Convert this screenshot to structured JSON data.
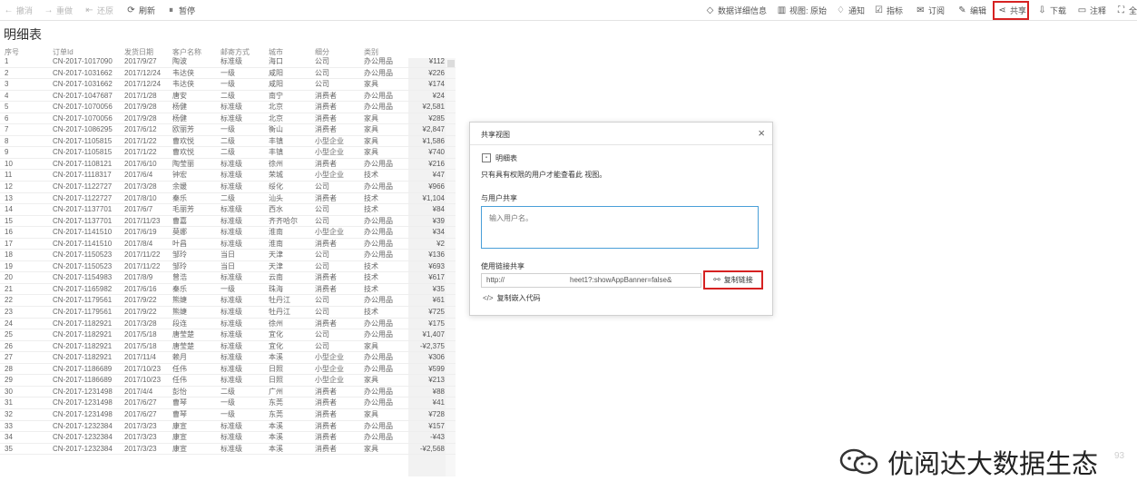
{
  "toolbar": {
    "undo": "撤消",
    "redo": "重做",
    "revert": "还原",
    "refresh": "刷新",
    "pause": "暂停",
    "data_details": "数据详细信息",
    "view": "视图: 原始",
    "alert": "通知",
    "metrics": "指标",
    "subscribe": "订阅",
    "edit": "编辑",
    "share": "共享",
    "download": "下载",
    "comments": "注释",
    "fullscreen": "全屏"
  },
  "sheet_title": "明细表",
  "table": {
    "headers": [
      "序号",
      "订单Id",
      "发货日期",
      "客户名称",
      "邮寄方式",
      "城市",
      "细分",
      "类别"
    ],
    "rows": [
      [
        "1",
        "CN-2017-1017090",
        "2017/9/27",
        "陶波",
        "标准级",
        "海口",
        "公司",
        "办公用品",
        "¥112"
      ],
      [
        "2",
        "CN-2017-1031662",
        "2017/12/24",
        "韦达侠",
        "一级",
        "咸阳",
        "公司",
        "办公用品",
        "¥226"
      ],
      [
        "3",
        "CN-2017-1031662",
        "2017/12/24",
        "韦达侠",
        "一级",
        "咸阳",
        "公司",
        "家具",
        "¥174"
      ],
      [
        "4",
        "CN-2017-1047687",
        "2017/1/28",
        "唐安",
        "二级",
        "南宁",
        "消费者",
        "办公用品",
        "¥24"
      ],
      [
        "5",
        "CN-2017-1070056",
        "2017/9/28",
        "杨健",
        "标准级",
        "北京",
        "消费者",
        "办公用品",
        "¥2,581"
      ],
      [
        "6",
        "CN-2017-1070056",
        "2017/9/28",
        "杨健",
        "标准级",
        "北京",
        "消费者",
        "家具",
        "¥285"
      ],
      [
        "7",
        "CN-2017-1086295",
        "2017/6/12",
        "欧丽芳",
        "一级",
        "衡山",
        "消费者",
        "家具",
        "¥2,847"
      ],
      [
        "8",
        "CN-2017-1105815",
        "2017/1/22",
        "曹欢悦",
        "二级",
        "丰镇",
        "小型企业",
        "家具",
        "¥1,586"
      ],
      [
        "9",
        "CN-2017-1105815",
        "2017/1/22",
        "曹欢悦",
        "二级",
        "丰镇",
        "小型企业",
        "家具",
        "¥740"
      ],
      [
        "10",
        "CN-2017-1108121",
        "2017/6/10",
        "陶莹丽",
        "标准级",
        "徐州",
        "消费者",
        "办公用品",
        "¥216"
      ],
      [
        "11",
        "CN-2017-1118317",
        "2017/6/4",
        "钟宏",
        "标准级",
        "荣城",
        "小型企业",
        "技术",
        "¥47"
      ],
      [
        "12",
        "CN-2017-1122727",
        "2017/3/28",
        "余媛",
        "标准级",
        "绥化",
        "公司",
        "办公用品",
        "¥966"
      ],
      [
        "13",
        "CN-2017-1122727",
        "2017/8/10",
        "秦乐",
        "二级",
        "汕头",
        "消费者",
        "技术",
        "¥1,104"
      ],
      [
        "14",
        "CN-2017-1137701",
        "2017/6/7",
        "毛丽芳",
        "标准级",
        "西水",
        "公司",
        "技术",
        "¥84"
      ],
      [
        "15",
        "CN-2017-1137701",
        "2017/11/23",
        "曹嘉",
        "标准级",
        "齐齐哈尔",
        "公司",
        "办公用品",
        "¥39"
      ],
      [
        "16",
        "CN-2017-1141510",
        "2017/6/19",
        "莫娜",
        "标准级",
        "淮南",
        "小型企业",
        "办公用品",
        "¥34"
      ],
      [
        "17",
        "CN-2017-1141510",
        "2017/8/4",
        "叶昌",
        "标准级",
        "淮南",
        "消费者",
        "办公用品",
        "¥2"
      ],
      [
        "18",
        "CN-2017-1150523",
        "2017/11/22",
        "邹玲",
        "当日",
        "天津",
        "公司",
        "办公用品",
        "¥136"
      ],
      [
        "19",
        "CN-2017-1150523",
        "2017/11/22",
        "邹玲",
        "当日",
        "天津",
        "公司",
        "技术",
        "¥693"
      ],
      [
        "20",
        "CN-2017-1154983",
        "2017/8/9",
        "曾浩",
        "标准级",
        "云南",
        "消费者",
        "技术",
        "¥617"
      ],
      [
        "21",
        "CN-2017-1165982",
        "2017/6/16",
        "秦乐",
        "一级",
        "珠海",
        "消费者",
        "技术",
        "¥35"
      ],
      [
        "22",
        "CN-2017-1179561",
        "2017/9/22",
        "熊婕",
        "标准级",
        "牡丹江",
        "公司",
        "办公用品",
        "¥61"
      ],
      [
        "23",
        "CN-2017-1179561",
        "2017/9/22",
        "熊婕",
        "标准级",
        "牡丹江",
        "公司",
        "技术",
        "¥725"
      ],
      [
        "24",
        "CN-2017-1182921",
        "2017/3/28",
        "段连",
        "标准级",
        "徐州",
        "消费者",
        "办公用品",
        "¥175"
      ],
      [
        "25",
        "CN-2017-1182921",
        "2017/5/18",
        "唐莹楚",
        "标准级",
        "宜化",
        "公司",
        "办公用品",
        "¥1,407"
      ],
      [
        "26",
        "CN-2017-1182921",
        "2017/5/18",
        "唐莹楚",
        "标准级",
        "宜化",
        "公司",
        "家具",
        "-¥2,375"
      ],
      [
        "27",
        "CN-2017-1182921",
        "2017/11/4",
        "赖月",
        "标准级",
        "本溪",
        "小型企业",
        "办公用品",
        "¥306"
      ],
      [
        "28",
        "CN-2017-1186689",
        "2017/10/23",
        "任伟",
        "标准级",
        "日照",
        "小型企业",
        "办公用品",
        "¥599"
      ],
      [
        "29",
        "CN-2017-1186689",
        "2017/10/23",
        "任伟",
        "标准级",
        "日照",
        "小型企业",
        "家具",
        "¥213"
      ],
      [
        "30",
        "CN-2017-1231498",
        "2017/4/4",
        "彭怡",
        "二级",
        "广州",
        "消费者",
        "办公用品",
        "¥88"
      ],
      [
        "31",
        "CN-2017-1231498",
        "2017/6/27",
        "曹琴",
        "一级",
        "东莞",
        "消费者",
        "办公用品",
        "¥41"
      ],
      [
        "32",
        "CN-2017-1231498",
        "2017/6/27",
        "曹琴",
        "一级",
        "东莞",
        "消费者",
        "家具",
        "¥728"
      ],
      [
        "33",
        "CN-2017-1232384",
        "2017/3/23",
        "康宣",
        "标准级",
        "本溪",
        "消费者",
        "办公用品",
        "¥157"
      ],
      [
        "34",
        "CN-2017-1232384",
        "2017/3/23",
        "康宣",
        "标准级",
        "本溪",
        "消费者",
        "办公用品",
        "-¥43"
      ],
      [
        "35",
        "CN-2017-1232384",
        "2017/3/23",
        "康宣",
        "标准级",
        "本溪",
        "消费者",
        "家具",
        "-¥2,568"
      ]
    ]
  },
  "share_dialog": {
    "title": "共享视图",
    "sheet_name": "明细表",
    "access_note": "只有具有权限的用户才能查看此 视图。",
    "with_users_label": "与用户共享",
    "user_input_placeholder": "输入用户名。",
    "link_label": "使用链接共享",
    "link_prefix": "http://",
    "link_suffix": "heet1?:showAppBanner=false&",
    "copy_link": "复制链接",
    "embed_code": "复制嵌入代码"
  },
  "watermark": {
    "text": "优阅达大数据生态",
    "tail": "93"
  },
  "colors": {
    "highlight": "#d62222",
    "input_focus": "#4a9fd8"
  }
}
